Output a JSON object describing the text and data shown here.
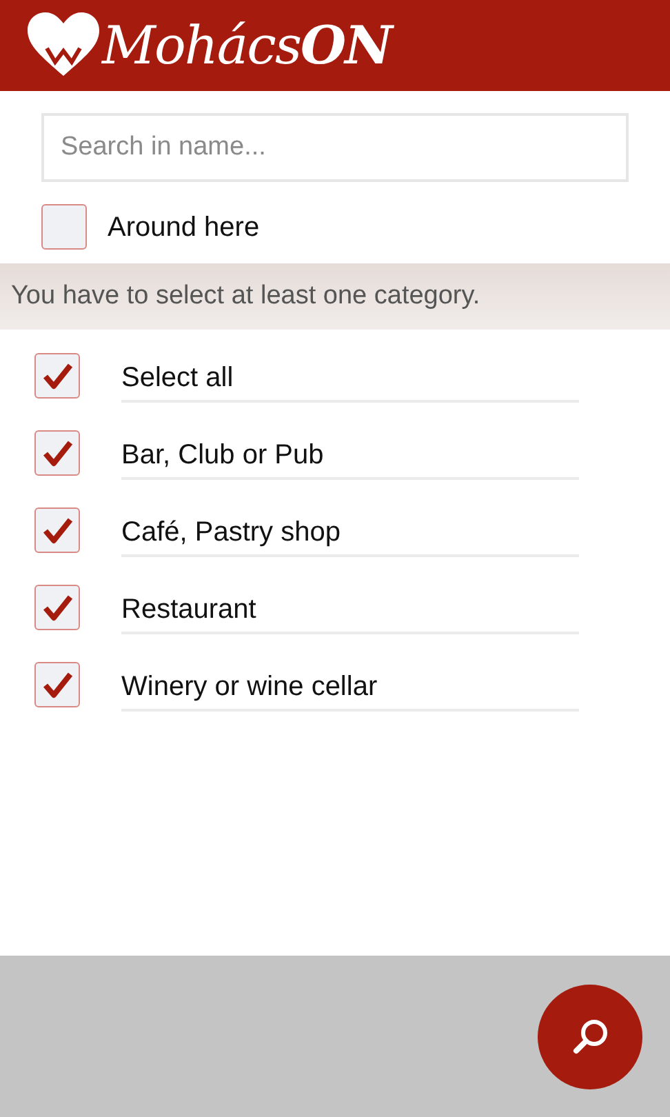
{
  "header": {
    "logo": "Mohács**ON**"
  },
  "search": {
    "placeholder": "Search in name..."
  },
  "around_here": {
    "label": "Around here",
    "checked": false
  },
  "message": "You have to select at least one category.",
  "categories": [
    {
      "label": "Select all",
      "checked": true
    },
    {
      "label": "Bar, Club or Pub",
      "checked": true
    },
    {
      "label": "Café, Pastry shop",
      "checked": true
    },
    {
      "label": "Restaurant",
      "checked": true
    },
    {
      "label": "Winery or wine cellar",
      "checked": true
    }
  ]
}
